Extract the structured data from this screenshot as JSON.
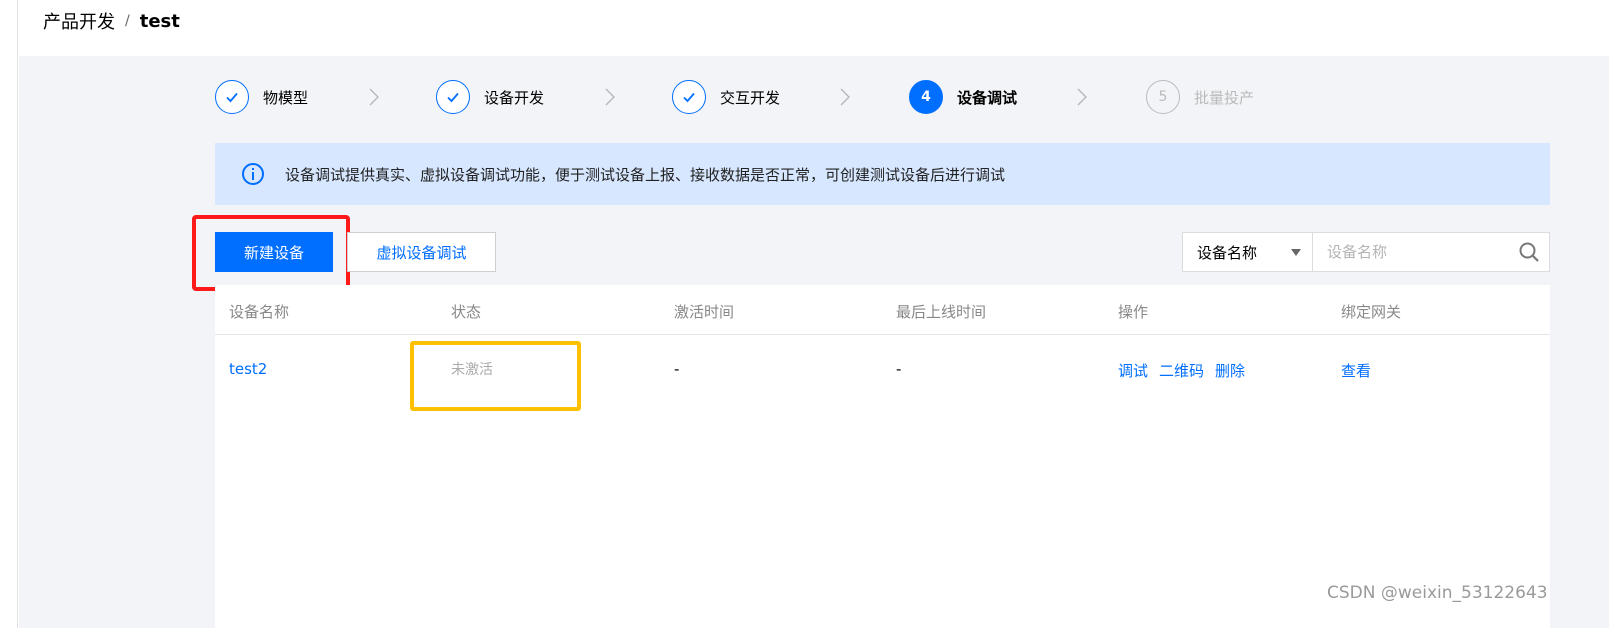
{
  "breadcrumb": {
    "parent": "产品开发",
    "separator": "/",
    "current": "test"
  },
  "steps": [
    {
      "label": "物模型",
      "state": "done"
    },
    {
      "label": "设备开发",
      "state": "done"
    },
    {
      "label": "交互开发",
      "state": "done"
    },
    {
      "number": "4",
      "label": "设备调试",
      "state": "active"
    },
    {
      "number": "5",
      "label": "批量投产",
      "state": "pending"
    }
  ],
  "info": {
    "text": "设备调试提供真实、虚拟设备调试功能，便于测试设备上报、接收数据是否正常，可创建测试设备后进行调试"
  },
  "toolbar": {
    "new_device": "新建设备",
    "virtual_debug": "虚拟设备调试",
    "search_field": "设备名称",
    "search_placeholder": "设备名称"
  },
  "table": {
    "columns": [
      "设备名称",
      "状态",
      "激活时间",
      "最后上线时间",
      "操作",
      "绑定网关"
    ],
    "rows": [
      {
        "name": "test2",
        "status": "未激活",
        "activated_at": "-",
        "last_online": "-",
        "actions": [
          "调试",
          "二维码",
          "删除"
        ],
        "gateway": "查看"
      }
    ]
  },
  "watermark": "CSDN @weixin_53122643",
  "colors": {
    "primary": "#006eff",
    "info_bg": "#d6e7ff",
    "highlight_red": "#ff1a1a",
    "highlight_yellow": "#ffc000"
  }
}
